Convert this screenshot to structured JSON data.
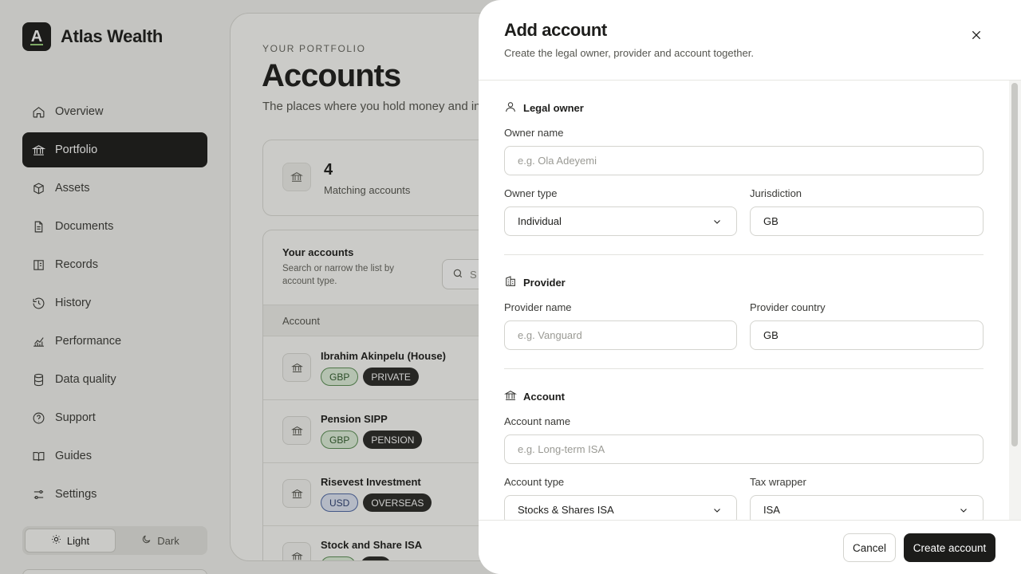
{
  "brand": {
    "logo_letter": "A",
    "name": "Atlas Wealth"
  },
  "nav": {
    "items": [
      {
        "label": "Overview",
        "icon": "home-icon"
      },
      {
        "label": "Portfolio",
        "icon": "bank-icon",
        "active": true
      },
      {
        "label": "Assets",
        "icon": "assets-icon"
      },
      {
        "label": "Documents",
        "icon": "document-icon"
      },
      {
        "label": "Records",
        "icon": "records-icon"
      },
      {
        "label": "History",
        "icon": "history-icon"
      },
      {
        "label": "Performance",
        "icon": "chart-icon"
      },
      {
        "label": "Data quality",
        "icon": "database-icon"
      },
      {
        "label": "Support",
        "icon": "help-icon"
      },
      {
        "label": "Guides",
        "icon": "book-icon"
      },
      {
        "label": "Settings",
        "icon": "sliders-icon"
      }
    ]
  },
  "theme": {
    "light": "Light",
    "dark": "Dark",
    "selected": "Light"
  },
  "page": {
    "eyebrow": "YOUR PORTFOLIO",
    "title": "Accounts",
    "subtitle": "The places where you hold money and inve"
  },
  "stat": {
    "value": "4",
    "label": "Matching accounts"
  },
  "accounts": {
    "title": "Your accounts",
    "subtitle": "Search or narrow the list by account type.",
    "search_placeholder": "S",
    "column_account": "Account",
    "rows": [
      {
        "name": "Ibrahim Akinpelu (House)",
        "currency": "GBP",
        "type": "PRIVATE"
      },
      {
        "name": "Pension SIPP",
        "currency": "GBP",
        "type": "PENSION"
      },
      {
        "name": "Risevest Investment",
        "currency": "USD",
        "type": "OVERSEAS"
      },
      {
        "name": "Stock and Share ISA",
        "currency": "",
        "type": ""
      }
    ]
  },
  "modal": {
    "title": "Add account",
    "subtitle": "Create the legal owner, provider and account together.",
    "sections": {
      "owner": {
        "heading": "Legal owner",
        "owner_name_label": "Owner name",
        "owner_name_placeholder": "e.g. Ola Adeyemi",
        "owner_type_label": "Owner type",
        "owner_type_value": "Individual",
        "jurisdiction_label": "Jurisdiction",
        "jurisdiction_value": "GB"
      },
      "provider": {
        "heading": "Provider",
        "provider_name_label": "Provider name",
        "provider_name_placeholder": "e.g. Vanguard",
        "provider_country_label": "Provider country",
        "provider_country_value": "GB"
      },
      "account": {
        "heading": "Account",
        "account_name_label": "Account name",
        "account_name_placeholder": "e.g. Long-term ISA",
        "account_type_label": "Account type",
        "account_type_value": "Stocks & Shares ISA",
        "tax_wrapper_label": "Tax wrapper",
        "tax_wrapper_value": "ISA"
      }
    },
    "cancel_label": "Cancel",
    "create_label": "Create account"
  }
}
